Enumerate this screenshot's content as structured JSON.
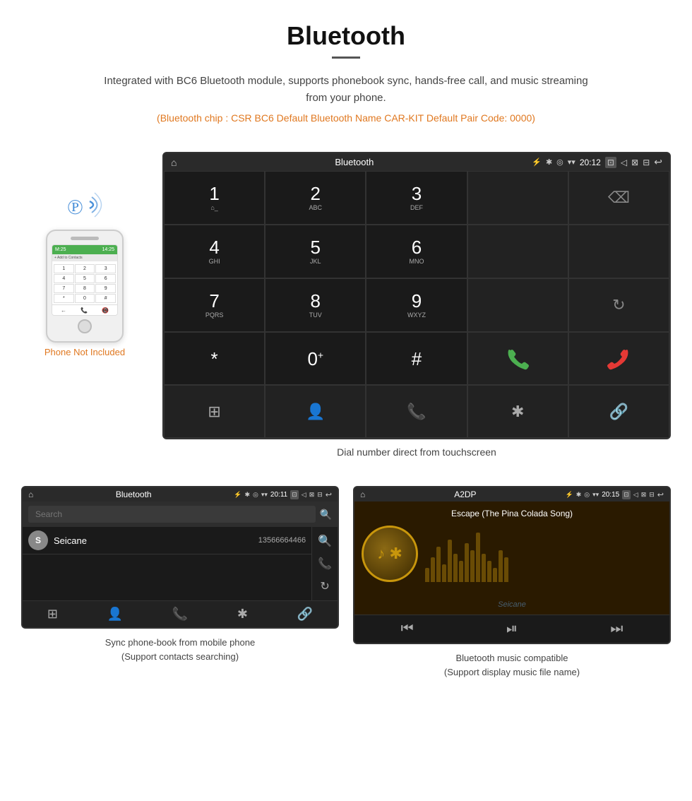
{
  "header": {
    "title": "Bluetooth",
    "description": "Integrated with BC6 Bluetooth module, supports phonebook sync, hands-free call, and music streaming from your phone.",
    "specs": "(Bluetooth chip : CSR BC6    Default Bluetooth Name CAR-KIT     Default Pair Code: 0000)"
  },
  "phone_label": "Phone Not Included",
  "dial_screen": {
    "title": "Bluetooth",
    "time": "20:12",
    "keys": [
      {
        "number": "1",
        "letters": "⌂"
      },
      {
        "number": "2",
        "letters": "ABC"
      },
      {
        "number": "3",
        "letters": "DEF"
      },
      {
        "number": "",
        "letters": ""
      },
      {
        "number": "⌫",
        "letters": ""
      },
      {
        "number": "4",
        "letters": "GHI"
      },
      {
        "number": "5",
        "letters": "JKL"
      },
      {
        "number": "6",
        "letters": "MNO"
      },
      {
        "number": "",
        "letters": ""
      },
      {
        "number": "",
        "letters": ""
      },
      {
        "number": "7",
        "letters": "PQRS"
      },
      {
        "number": "8",
        "letters": "TUV"
      },
      {
        "number": "9",
        "letters": "WXYZ"
      },
      {
        "number": "",
        "letters": ""
      },
      {
        "number": "↻",
        "letters": ""
      },
      {
        "number": "*",
        "letters": ""
      },
      {
        "number": "0+",
        "letters": ""
      },
      {
        "number": "#",
        "letters": ""
      },
      {
        "number": "📞",
        "letters": ""
      },
      {
        "number": "📞",
        "letters": "end"
      }
    ],
    "caption": "Dial number direct from touchscreen"
  },
  "phonebook_screen": {
    "title": "Bluetooth",
    "time": "20:11",
    "search_placeholder": "Search",
    "contact": {
      "initial": "S",
      "name": "Seicane",
      "number": "13566664466"
    },
    "caption_line1": "Sync phone-book from mobile phone",
    "caption_line2": "(Support contacts searching)"
  },
  "music_screen": {
    "title": "A2DP",
    "time": "20:15",
    "song_title": "Escape (The Pina Colada Song)",
    "caption_line1": "Bluetooth music compatible",
    "caption_line2": "(Support display music file name)"
  },
  "watermark": "Seicane",
  "colors": {
    "accent_orange": "#e07820",
    "android_dark": "#1a1a1a",
    "status_bar": "#2a2a2a",
    "green_call": "#4CAF50",
    "red_call": "#e53935",
    "bt_blue": "#4A90D9"
  }
}
